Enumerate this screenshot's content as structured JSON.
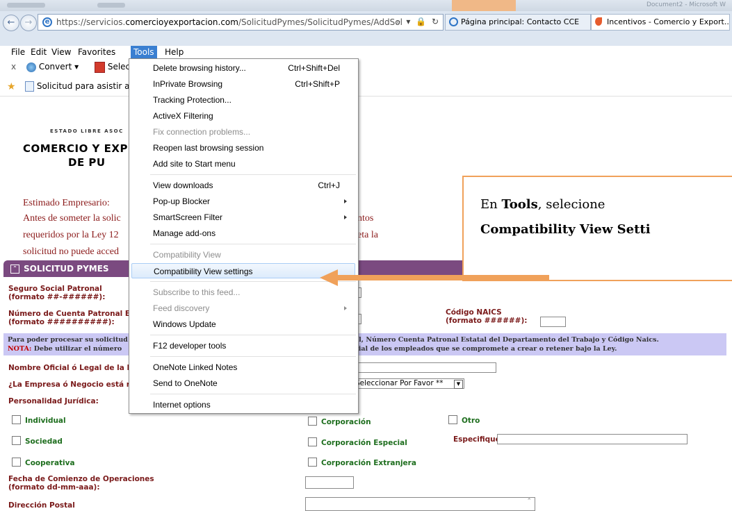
{
  "browser": {
    "url_prefix": "https://servicios.",
    "url_domain": "comercioyexportacion.com",
    "url_suffix": "/SolicitudPymes/SolicitudPymes/AddSol",
    "url_tools": "⌕ ▾ 🔒 ↻",
    "tabs": [
      {
        "title": "Página principal: Contacto CCE"
      },
      {
        "title": "Incentivos - Comercio y Export..."
      }
    ],
    "title_right": "Document2 - Microsoft W"
  },
  "menubar": {
    "items": [
      "File",
      "Edit",
      "View",
      "Favorites",
      "Tools",
      "Help"
    ],
    "open_item": "Tools"
  },
  "commandbar": {
    "close": "x",
    "convert": "Convert",
    "select": "Select"
  },
  "favorites": {
    "item": "Solicitud para asistir a lo"
  },
  "tools_menu": [
    {
      "label": "Delete browsing history...",
      "shortcut": "Ctrl+Shift+Del"
    },
    {
      "label": "InPrivate Browsing",
      "shortcut": "Ctrl+Shift+P"
    },
    {
      "label": "Tracking Protection..."
    },
    {
      "label": "ActiveX Filtering"
    },
    {
      "label": "Fix connection problems...",
      "disabled": true
    },
    {
      "label": "Reopen last browsing session"
    },
    {
      "label": "Add site to Start menu"
    },
    {
      "label": "View downloads",
      "shortcut": "Ctrl+J"
    },
    {
      "label": "Pop-up Blocker",
      "submenu": true
    },
    {
      "label": "SmartScreen Filter",
      "submenu": true
    },
    {
      "label": "Manage add-ons"
    },
    {
      "label": "Compatibility View",
      "disabled": true
    },
    {
      "label": "Compatibility View settings",
      "highlighted": true
    },
    {
      "label": "Subscribe to this feed...",
      "disabled": true
    },
    {
      "label": "Feed discovery",
      "disabled": true,
      "submenu": true
    },
    {
      "label": "Windows Update"
    },
    {
      "label": "F12 developer tools"
    },
    {
      "label": "OneNote Linked Notes"
    },
    {
      "label": "Send to OneNote"
    },
    {
      "label": "Internet options"
    }
  ],
  "page": {
    "estado": "ESTADO LIBRE ASOC",
    "headline1": "COMERCIO Y EXP",
    "headline2": "DE PU",
    "greeting": "Estimado Empresario:",
    "para1_left": "Antes de someter la solic",
    "para1_right": "ntos",
    "para2_left": "requeridos por la Ley 12",
    "para2_right": "eta la",
    "para3_left": "solicitud no puede acced"
  },
  "form": {
    "section_title": "SOLICITUD PYMES",
    "seguro_label": "Seguro Social Patronal",
    "seguro_format": "(formato ##-######):",
    "cuenta_label": "Número de Cuenta Patronal E",
    "cuenta_format": "(formato ##########):",
    "naics_label": "Código NAICS",
    "naics_format": "(formato ######):",
    "nota_line1_left": "Para poder procesar su solicitud",
    "nota_line1_right": "al, Número Cuenta Patronal Estatal del Departamento del Trabajo y Código Naics.",
    "nota_label": "NOTA:",
    "nota_line2_left": "Debe utilizar el número",
    "nota_line2_right": "cial de los empleados que se compromete a crear o retener bajo la Ley.",
    "nombre_label": "Nombre Oficial ó Legal de la E",
    "empresa_label": "¿La Empresa ó Negocio está re",
    "select_value": "Seleccionar Por Favor **",
    "personalidad_label": "Personalidad Jurídica:",
    "individual": "Individual",
    "sociedad": "Sociedad",
    "cooperativa": "Cooperativa",
    "corporacion": "Corporación",
    "corp_especial": "Corporación Especial",
    "corp_extranjera": "Corporación Extranjera",
    "otro": "Otro",
    "especifique": "Especifique:",
    "fecha_label": "Fecha de Comienzo de Operaciones",
    "fecha_format": "(formato dd-mm-aaa):",
    "direccion_label": "Dirección Postal"
  },
  "callout": {
    "prefix": "En ",
    "tools_word": "Tools",
    "suffix": ", selecione",
    "line2": "Compatibility  View Setti"
  },
  "colors": {
    "menu_highlight": "#3a7fd1",
    "section_purple": "#7b4a80",
    "arrow_orange": "#f0a15a",
    "label_red": "#7a1a1a",
    "label_green": "#1e6e1e",
    "nota_bg": "#cbc8f4"
  }
}
